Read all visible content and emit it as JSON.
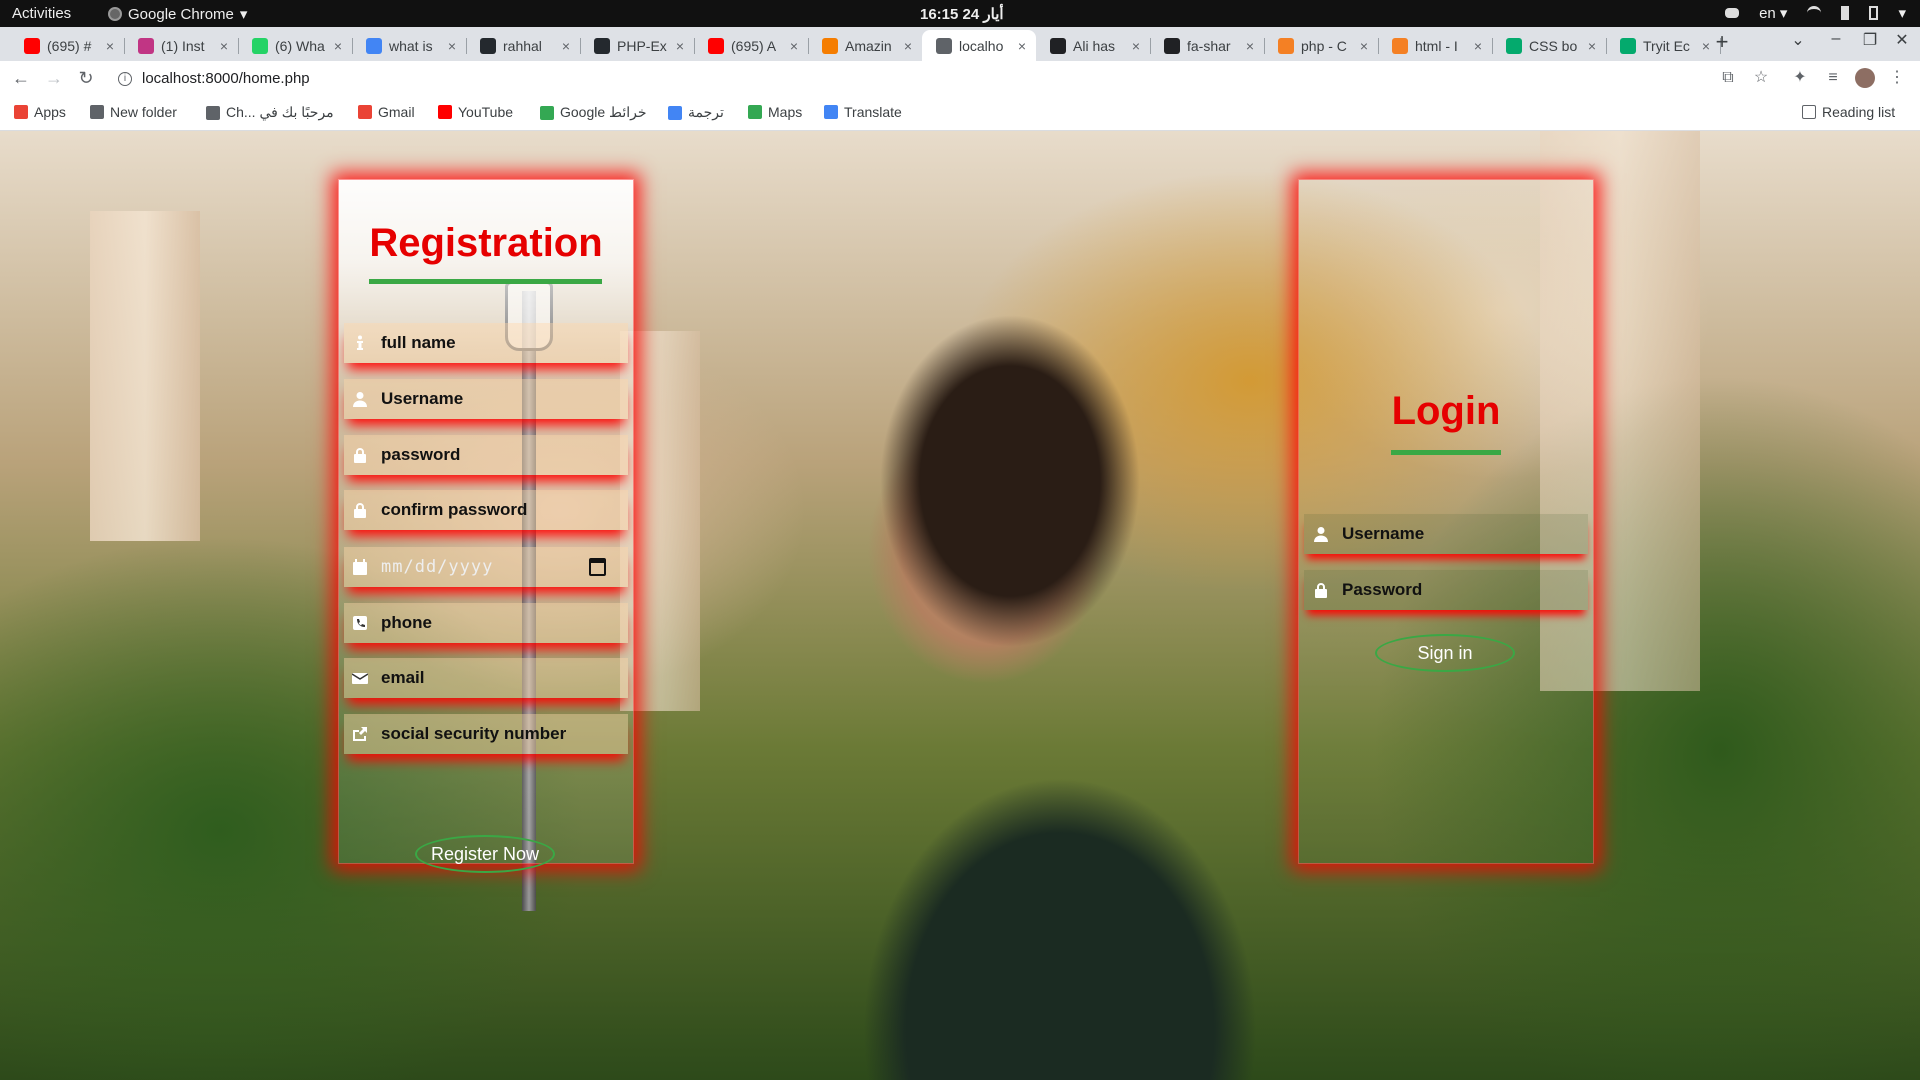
{
  "os_bar": {
    "activities": "Activities",
    "app_name": "Google Chrome",
    "app_menu_arrow": "▾",
    "clock": "16:15  24 أيار",
    "lang": "en ▾"
  },
  "tabs": [
    {
      "label": "(695) #",
      "favicon": "youtube-icon",
      "color": "#ff0000"
    },
    {
      "label": "(1) Inst",
      "favicon": "instagram-icon",
      "color": "#c13584"
    },
    {
      "label": "(6) Wha",
      "favicon": "whatsapp-icon",
      "color": "#25d366"
    },
    {
      "label": "what is",
      "favicon": "google-icon",
      "color": "#4285f4"
    },
    {
      "label": "rahhal",
      "favicon": "github-icon",
      "color": "#24292e"
    },
    {
      "label": "PHP-Ex",
      "favicon": "github-icon",
      "color": "#24292e"
    },
    {
      "label": "(695) A",
      "favicon": "youtube-icon",
      "color": "#ff0000"
    },
    {
      "label": "Amazin",
      "favicon": "blogger-icon",
      "color": "#f57d00"
    },
    {
      "label": "localho",
      "favicon": "globe-icon",
      "color": "#5f6368",
      "active": true
    },
    {
      "label": "Ali has",
      "favicon": "book-icon",
      "color": "#202124"
    },
    {
      "label": "fa-shar",
      "favicon": "image-icon",
      "color": "#202124"
    },
    {
      "label": "php - C",
      "favicon": "stackoverflow-icon",
      "color": "#f48024"
    },
    {
      "label": "html - I",
      "favicon": "stackoverflow-icon",
      "color": "#f48024"
    },
    {
      "label": "CSS bo",
      "favicon": "w3schools-icon",
      "color": "#04aa6d"
    },
    {
      "label": "Tryit Ec",
      "favicon": "w3schools-icon",
      "color": "#04aa6d"
    }
  ],
  "tab_close": "×",
  "new_tab": "+",
  "address_bar": {
    "url": "localhost:8000/home.php"
  },
  "bookmarks": [
    {
      "label": "Apps",
      "icon": "apps-grid-icon",
      "color": "#ea4335"
    },
    {
      "label": "New folder",
      "icon": "folder-icon",
      "color": "#5f6368"
    },
    {
      "label": "Ch... مرحبًا بك في",
      "icon": "globe-icon",
      "color": "#5f6368"
    },
    {
      "label": "Gmail",
      "icon": "gmail-icon",
      "color": "#ea4335"
    },
    {
      "label": "YouTube",
      "icon": "youtube-icon",
      "color": "#ff0000"
    },
    {
      "label": "Google خرائط",
      "icon": "maps-pin-icon",
      "color": "#34a853"
    },
    {
      "label": "ترجمة",
      "icon": "translate-icon",
      "color": "#4285f4"
    },
    {
      "label": "Maps",
      "icon": "maps-pin-icon",
      "color": "#34a853"
    },
    {
      "label": "Translate",
      "icon": "translate-icon",
      "color": "#4285f4"
    }
  ],
  "reading_list": "Reading list",
  "registration": {
    "title": "Registration",
    "fields": [
      {
        "placeholder": "full name",
        "icon": "info-icon"
      },
      {
        "placeholder": "Username",
        "icon": "user-icon"
      },
      {
        "placeholder": "password",
        "icon": "lock-icon"
      },
      {
        "placeholder": "confirm password",
        "icon": "lock-icon"
      },
      {
        "placeholder": "mm/dd/yyyy",
        "icon": "calendar-icon"
      },
      {
        "placeholder": "phone",
        "icon": "phone-icon"
      },
      {
        "placeholder": "email",
        "icon": "envelope-icon"
      },
      {
        "placeholder": "social security number",
        "icon": "share-square-icon"
      }
    ],
    "submit": "Register Now"
  },
  "login": {
    "title": "Login",
    "fields": [
      {
        "placeholder": "Username",
        "icon": "user-icon"
      },
      {
        "placeholder": "Password",
        "icon": "lock-icon"
      }
    ],
    "submit": "Sign in"
  },
  "colors": {
    "title_red": "#e60000",
    "accent_green": "#3aa845",
    "glow_red": "#ff0000"
  }
}
